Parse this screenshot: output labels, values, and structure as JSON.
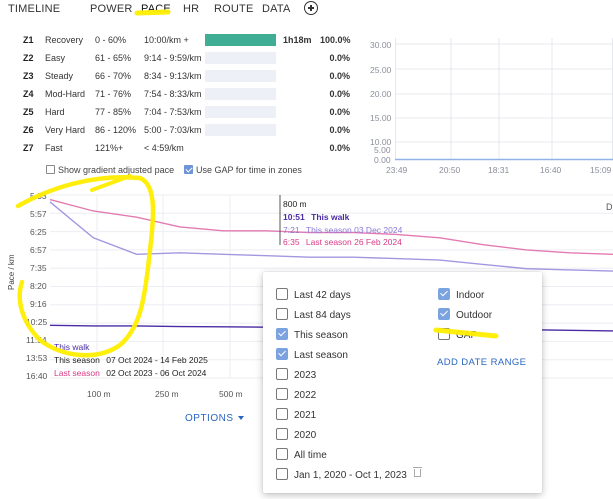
{
  "tabs": [
    "TIMELINE",
    "POWER",
    "PACE",
    "HR",
    "ROUTE",
    "DATA"
  ],
  "active_tab": "PACE",
  "zones": [
    {
      "code": "Z1",
      "name": "Recovery",
      "pct": "0 - 60%",
      "pace": "10:00/km +",
      "time": "1h18m",
      "share": "100.0%",
      "fill": 1.0
    },
    {
      "code": "Z2",
      "name": "Easy",
      "pct": "61 - 65%",
      "pace": "9:14 - 9:59/km",
      "time": "",
      "share": "0.0%",
      "fill": 0
    },
    {
      "code": "Z3",
      "name": "Steady",
      "pct": "66 - 70%",
      "pace": "8:34 - 9:13/km",
      "time": "",
      "share": "0.0%",
      "fill": 0
    },
    {
      "code": "Z4",
      "name": "Mod-Hard",
      "pct": "71 - 76%",
      "pace": "7:54 - 8:33/km",
      "time": "",
      "share": "0.0%",
      "fill": 0
    },
    {
      "code": "Z5",
      "name": "Hard",
      "pct": "77 - 85%",
      "pace": "7:04 - 7:53/km",
      "time": "",
      "share": "0.0%",
      "fill": 0
    },
    {
      "code": "Z6",
      "name": "Very Hard",
      "pct": "86 - 120%",
      "pace": "5:00 - 7:03/km",
      "time": "",
      "share": "0.0%",
      "fill": 0
    },
    {
      "code": "Z7",
      "name": "Fast",
      "pct": "121%+",
      "pace": "< 4:59/km",
      "time": "",
      "share": "0.0%",
      "fill": 0
    }
  ],
  "options_row": {
    "gradient_label": "Show gradient adjusted pace",
    "gradient_checked": false,
    "gap_label": "Use GAP for time in zones",
    "gap_checked": true
  },
  "mini_chart": {
    "y_ticks": [
      "30.00",
      "25.00",
      "20.00",
      "15.00",
      "10.00",
      "5.00",
      "0.00"
    ],
    "x_ticks": [
      "23:49",
      "20:50",
      "18:31",
      "16:40",
      "15:09"
    ]
  },
  "chart_data": {
    "type": "line",
    "ylabel": "Pace / km",
    "y_ticks": [
      "5:33",
      "5:57",
      "6:25",
      "6:57",
      "7:35",
      "8:20",
      "9:16",
      "10:25",
      "11:54",
      "13:53",
      "16:40"
    ],
    "x_ticks": [
      "100 m",
      "250 m",
      "500 m"
    ],
    "series": [
      {
        "name": "This walk",
        "color": "#4a2aa5",
        "values": [
          10.6,
          10.65,
          10.65,
          10.7,
          10.72,
          10.75,
          10.72,
          10.8,
          10.82,
          10.85,
          10.9,
          10.95,
          11.0,
          11.05
        ]
      },
      {
        "name": "This season",
        "color": "#a397e0",
        "values": [
          5.7,
          6.6,
          7.1,
          7.05,
          7.1,
          7.15,
          7.2,
          7.2,
          7.25,
          7.3,
          7.45,
          7.6,
          7.65,
          7.7
        ]
      },
      {
        "name": "Last season",
        "color": "#e37bb2",
        "values": [
          5.65,
          5.9,
          6.05,
          6.3,
          6.4,
          6.4,
          6.45,
          6.45,
          6.5,
          6.6,
          6.8,
          6.95,
          7.05,
          7.1
        ]
      }
    ]
  },
  "legend": {
    "this_walk": "This walk",
    "this_season": "This season",
    "this_season_dates": "07 Oct 2024 - 14 Feb 2025",
    "last_season": "Last season",
    "last_season_dates": "02 Oct 2023 - 06 Oct 2024"
  },
  "tooltip": {
    "distance": "800 m",
    "rows": [
      {
        "pace": "10:51",
        "label": "This walk",
        "color": "#4a2aa5"
      },
      {
        "pace": "7:21",
        "label": "This season 03 Dec 2024",
        "color": "#8a7ad8"
      },
      {
        "pace": "6:35",
        "label": "Last season 26 Feb 2024",
        "color": "#d93a86"
      }
    ]
  },
  "right_edge_letter": "D",
  "options_button": "OPTIONS",
  "menu": {
    "left_items": [
      {
        "label": "Last 42 days",
        "checked": false
      },
      {
        "label": "Last 84 days",
        "checked": false
      },
      {
        "label": "This season",
        "checked": true
      },
      {
        "label": "Last season",
        "checked": true
      },
      {
        "label": "2023",
        "checked": false
      },
      {
        "label": "2022",
        "checked": false
      },
      {
        "label": "2021",
        "checked": false
      },
      {
        "label": "2020",
        "checked": false
      },
      {
        "label": "All time",
        "checked": false
      },
      {
        "label": "Jan 1, 2020 - Oct 1, 2023",
        "checked": false
      }
    ],
    "right_items": [
      {
        "label": "Indoor",
        "checked": true
      },
      {
        "label": "Outdoor",
        "checked": true
      },
      {
        "label": "GAP",
        "checked": false
      }
    ],
    "add_range": "ADD DATE RANGE"
  },
  "colors": {
    "zone_fill": "#3fae95",
    "accent": "#2a66c1",
    "highlight": "#ffee00"
  }
}
